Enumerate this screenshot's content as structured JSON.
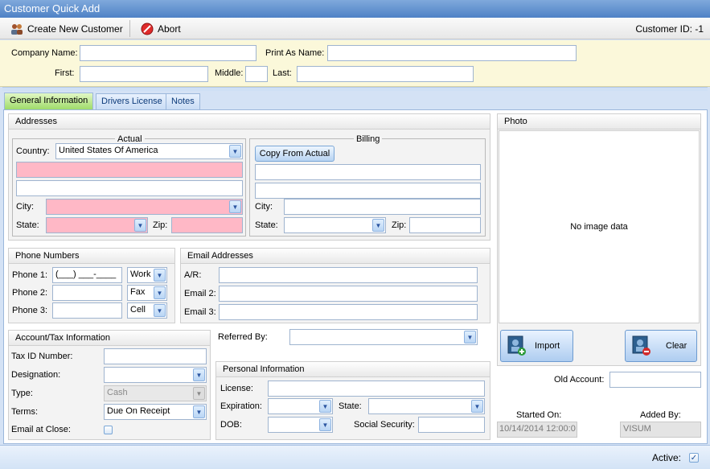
{
  "window": {
    "title": "Customer Quick Add"
  },
  "toolbar": {
    "create_label": "Create New Customer",
    "abort_label": "Abort",
    "customer_id": "Customer ID: -1"
  },
  "header": {
    "company_name_label": "Company Name:",
    "print_as_label": "Print As Name:",
    "first_label": "First:",
    "middle_label": "Middle:",
    "last_label": "Last:"
  },
  "tabs": [
    "General Information",
    "Drivers License",
    "Notes"
  ],
  "addresses": {
    "title": "Addresses",
    "actual_legend": "Actual",
    "billing_legend": "Billing",
    "country_label": "Country:",
    "country_value": "United States Of America",
    "city_label": "City:",
    "state_label": "State:",
    "zip_label": "Zip:",
    "copy_button": "Copy From Actual"
  },
  "phones": {
    "title": "Phone Numbers",
    "rows": [
      {
        "label": "Phone 1:",
        "value": "(___) ___-____",
        "type": "Work"
      },
      {
        "label": "Phone 2:",
        "value": "",
        "type": "Fax"
      },
      {
        "label": "Phone 3:",
        "value": "",
        "type": "Cell"
      }
    ]
  },
  "emails": {
    "title": "Email Addresses",
    "labels": [
      "A/R:",
      "Email 2:",
      "Email 3:"
    ]
  },
  "account": {
    "title": "Account/Tax Information",
    "tax_id_label": "Tax ID Number:",
    "designation_label": "Designation:",
    "type_label": "Type:",
    "type_value": "Cash",
    "terms_label": "Terms:",
    "terms_value": "Due On Receipt",
    "email_close_label": "Email at Close:"
  },
  "referred_label": "Referred By:",
  "personal": {
    "title": "Personal Information",
    "license_label": "License:",
    "expiration_label": "Expiration:",
    "state_label": "State:",
    "dob_label": "DOB:",
    "ssn_label": "Social Security:"
  },
  "photo": {
    "title": "Photo",
    "empty_text": "No image data",
    "import_label": "Import",
    "clear_label": "Clear"
  },
  "side": {
    "old_account_label": "Old Account:",
    "started_label": "Started On:",
    "started_value": "10/14/2014 12:00:0",
    "added_label": "Added By:",
    "added_value": "VISUM"
  },
  "status": {
    "active_label": "Active:"
  },
  "colors": {
    "required_field": "#ffb8c6",
    "active_tab": "#9fdc6a",
    "header_bg": "#fbf8da"
  }
}
